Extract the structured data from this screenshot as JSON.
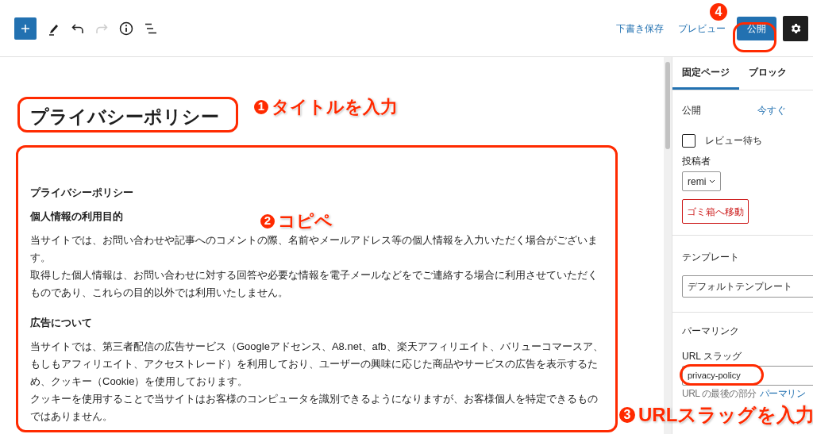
{
  "toolbar": {
    "left_tools": [
      {
        "kind": "add",
        "disabled": false
      },
      {
        "kind": "pen",
        "disabled": false
      },
      {
        "kind": "undo",
        "disabled": false
      },
      {
        "kind": "redo",
        "disabled": true
      },
      {
        "kind": "info",
        "disabled": false
      },
      {
        "kind": "list",
        "disabled": false
      }
    ],
    "save_draft": "下書き保存",
    "preview": "プレビュー",
    "publish": "公開"
  },
  "editor": {
    "title": "プライバシーポリシー",
    "blocks": [
      {
        "kind": "heading",
        "text": "プライバシーポリシー"
      },
      {
        "kind": "heading",
        "text": "個人情報の利用目的"
      },
      {
        "kind": "paragraph",
        "lines": [
          "当サイトでは、お問い合わせや記事へのコメントの際、名前やメールアドレス等の個人情報を入力いただく場合がございます。",
          "取得した個人情報は、お問い合わせに対する回答や必要な情報を電子メールなどをでご連絡する場合に利用させていただくものであり、これらの目的以外では利用いたしません。"
        ]
      },
      {
        "kind": "heading",
        "text": "広告について"
      },
      {
        "kind": "paragraph",
        "lines": [
          "当サイトでは、第三者配信の広告サービス（Googleアドセンス、A8.net、afb、楽天アフィリエイト、バリューコマースア、もしもアフィリエイト、アクセストレード）を利用しており、ユーザーの興味に応じた商品やサービスの広告を表示するため、クッキー（Cookie）を使用しております。",
          "クッキーを使用することで当サイトはお客様のコンピュータを識別できるようになりますが、お客様個人を特定できるものではありません。"
        ]
      }
    ]
  },
  "sidebar": {
    "tabs": [
      {
        "label": "固定ページ",
        "selected": true
      },
      {
        "label": "ブロック",
        "selected": false
      }
    ],
    "publish_label": "公開",
    "publish_value": "今すぐ",
    "pending_review": {
      "label": "レビュー待ち",
      "checked": false
    },
    "author_label": "投稿者",
    "author_value": "remi",
    "trash": "ゴミ箱へ移動",
    "template_heading": "テンプレート",
    "template_value": "デフォルトテンプレート",
    "permalink_heading": "パーマリンク",
    "slug_label": "URL スラッグ",
    "slug_value": "privacy-policy",
    "slug_help": "URL の最後の部分",
    "permalink_link": "パーマリン"
  },
  "annotations": [
    {
      "number": "4"
    },
    {
      "number": "1",
      "text": "タイトルを入力"
    },
    {
      "number": "2",
      "text": "コピペ"
    },
    {
      "number": "3",
      "text": "URLスラッグを入力"
    }
  ]
}
